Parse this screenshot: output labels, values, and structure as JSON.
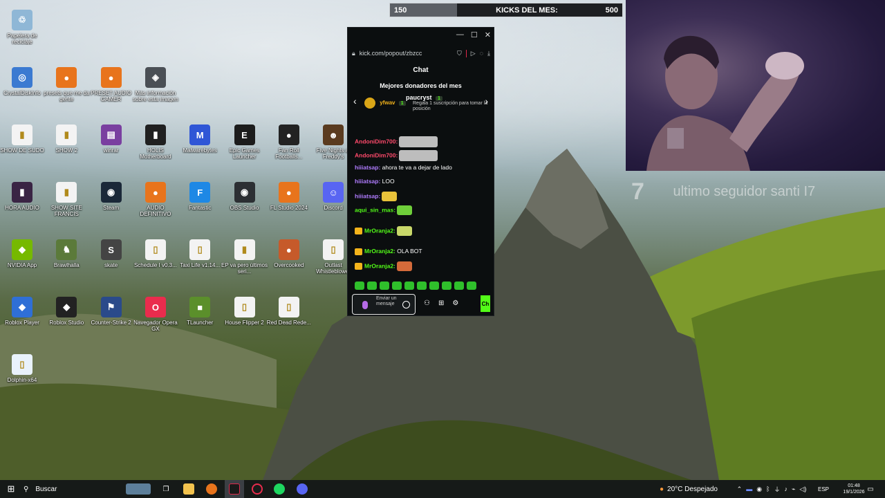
{
  "desktop": {
    "icons": [
      {
        "label": "Papelera de reciclaje",
        "color": "#8fb7d6",
        "glyph": "♲"
      },
      {
        "label": "CrystalDiskInfo",
        "color": "#3b7ad1",
        "glyph": "◎"
      },
      {
        "label": "presets que me da gente",
        "color": "#e8741c",
        "glyph": "●"
      },
      {
        "label": "PRESET AUDIO GAMER",
        "color": "#e8741c",
        "glyph": "●"
      },
      {
        "label": "Más información sobre esta imagen",
        "color": "#4a4f55",
        "glyph": "◈"
      },
      {
        "label": "SHOW DE SUDO",
        "color": "#f3f3f3",
        "glyph": "▮"
      },
      {
        "label": "SHOW 2",
        "color": "#f3f3f3",
        "glyph": "▮"
      },
      {
        "label": "winrar",
        "color": "#7a3fa0",
        "glyph": "▤"
      },
      {
        "label": "HOLIS Motherboard",
        "color": "#202020",
        "glyph": "▮"
      },
      {
        "label": "Malwarebytes",
        "color": "#2f56d6",
        "glyph": "M"
      },
      {
        "label": "Epic Games Launcher",
        "color": "#1c1c1c",
        "glyph": "E"
      },
      {
        "label": "Fan Roll Footballs...",
        "color": "#222",
        "glyph": "●"
      },
      {
        "label": "Five Nights at Freddy's",
        "color": "#5a3b1f",
        "glyph": "☻"
      },
      {
        "label": "HORA AUDIO",
        "color": "#3a2444",
        "glyph": "▮"
      },
      {
        "label": "SHOW SITE FRANCIS",
        "color": "#f3f3f3",
        "glyph": "▮"
      },
      {
        "label": "Steam",
        "color": "#1b2838",
        "glyph": "◉"
      },
      {
        "label": "AUDIO DEFINITIVO",
        "color": "#e8741c",
        "glyph": "●"
      },
      {
        "label": "Fantastic",
        "color": "#1e88e5",
        "glyph": "F"
      },
      {
        "label": "OBS Studio",
        "color": "#2c2f33",
        "glyph": "◉"
      },
      {
        "label": "FL Studio 2024",
        "color": "#e8741c",
        "glyph": "●"
      },
      {
        "label": "Discord",
        "color": "#5865f2",
        "glyph": "☺"
      },
      {
        "label": "NVIDIA App",
        "color": "#76b900",
        "glyph": "◆"
      },
      {
        "label": "Brawlhalla",
        "color": "#5b7a3a",
        "glyph": "♞"
      },
      {
        "label": "skate",
        "color": "#444",
        "glyph": "S"
      },
      {
        "label": "Schedule I v0.3...",
        "color": "#f3f3f3",
        "glyph": "▯"
      },
      {
        "label": "Taxi Life v1.14...",
        "color": "#f3f3f3",
        "glyph": "▯"
      },
      {
        "label": "EP va pero últimos seri...",
        "color": "#f3f3f3",
        "glyph": "▮"
      },
      {
        "label": "Overcooked",
        "color": "#c65a2a",
        "glyph": "●"
      },
      {
        "label": "Outlast Whistleblower",
        "color": "#f3f3f3",
        "glyph": "▯"
      },
      {
        "label": "Roblox Player",
        "color": "#2f6fd6",
        "glyph": "◆"
      },
      {
        "label": "Roblox Studio",
        "color": "#222",
        "glyph": "◆"
      },
      {
        "label": "Counter-Strike 2",
        "color": "#2a4a8a",
        "glyph": "⚑"
      },
      {
        "label": "Navegador Opera GX",
        "color": "#ea2c4d",
        "glyph": "O"
      },
      {
        "label": "TLauncher",
        "color": "#5b8f2b",
        "glyph": "■"
      },
      {
        "label": "House Flipper 2",
        "color": "#f3f3f3",
        "glyph": "▯"
      },
      {
        "label": "Red Dead Rede...",
        "color": "#f3f3f3",
        "glyph": "▯"
      },
      {
        "label": "Dolphin-x64",
        "color": "#e9f2fb",
        "glyph": "▯"
      }
    ]
  },
  "overlay": {
    "kicks_start": "150",
    "kicks_label": "KICKS DEL MES:",
    "kicks_goal": "500",
    "kicks_progress_fraction": 0.29,
    "follower_number": "7",
    "follower_text": "ultimo seguidor  santi I7"
  },
  "chat_window": {
    "url": "kick.com/popout/zbzcc",
    "title": "Chat",
    "donors_title": "Mejores donadores del mes",
    "donor_1_name": "yfwav",
    "donor_1_badge": "1",
    "donor_2_name": "paucryst",
    "donor_2_badge": "1",
    "donor_2_sub": "Regala 1 suscripción para tomar la posición",
    "messages": [
      {
        "user": "AndoniDim700:",
        "text": "",
        "color": "#ff4a6b",
        "emote": "#bdbdbd",
        "crown": false
      },
      {
        "user": "AndoniDim700:",
        "text": "",
        "color": "#ff4a6b",
        "emote": "#bdbdbd",
        "crown": false
      },
      {
        "user": "hiiiatsap:",
        "text": " ahora te va a dejar de lado",
        "color": "#b07cff",
        "emote": "",
        "crown": false
      },
      {
        "user": "hiiiatsap:",
        "text": " LOO",
        "color": "#b07cff",
        "emote": "",
        "crown": false
      },
      {
        "user": "hiiiatsap:",
        "text": "",
        "color": "#b07cff",
        "emote": "#e8c23a",
        "crown": false
      },
      {
        "user": "aqui_sin_mas:",
        "text": "",
        "color": "#53fc18",
        "emote": "#6fcf3a",
        "crown": false
      },
      {
        "user": "MrOranja2:",
        "text": "",
        "color": "#53fc18",
        "emote": "#c9d86a",
        "crown": true
      },
      {
        "user": "MrOranja2:",
        "text": " OLA BOT",
        "color": "#53fc18",
        "emote": "",
        "crown": true
      },
      {
        "user": "MrOranja2:",
        "text": "",
        "color": "#53fc18",
        "emote": "#d46a3a",
        "crown": true
      }
    ],
    "input_placeholder": "Enviar un mensaje",
    "send_label": "Ch"
  },
  "taskbar": {
    "search_label": "Buscar",
    "weather": "20°C Despejado",
    "language": "ESP",
    "time": "01:48",
    "date": "19/1/2026"
  }
}
